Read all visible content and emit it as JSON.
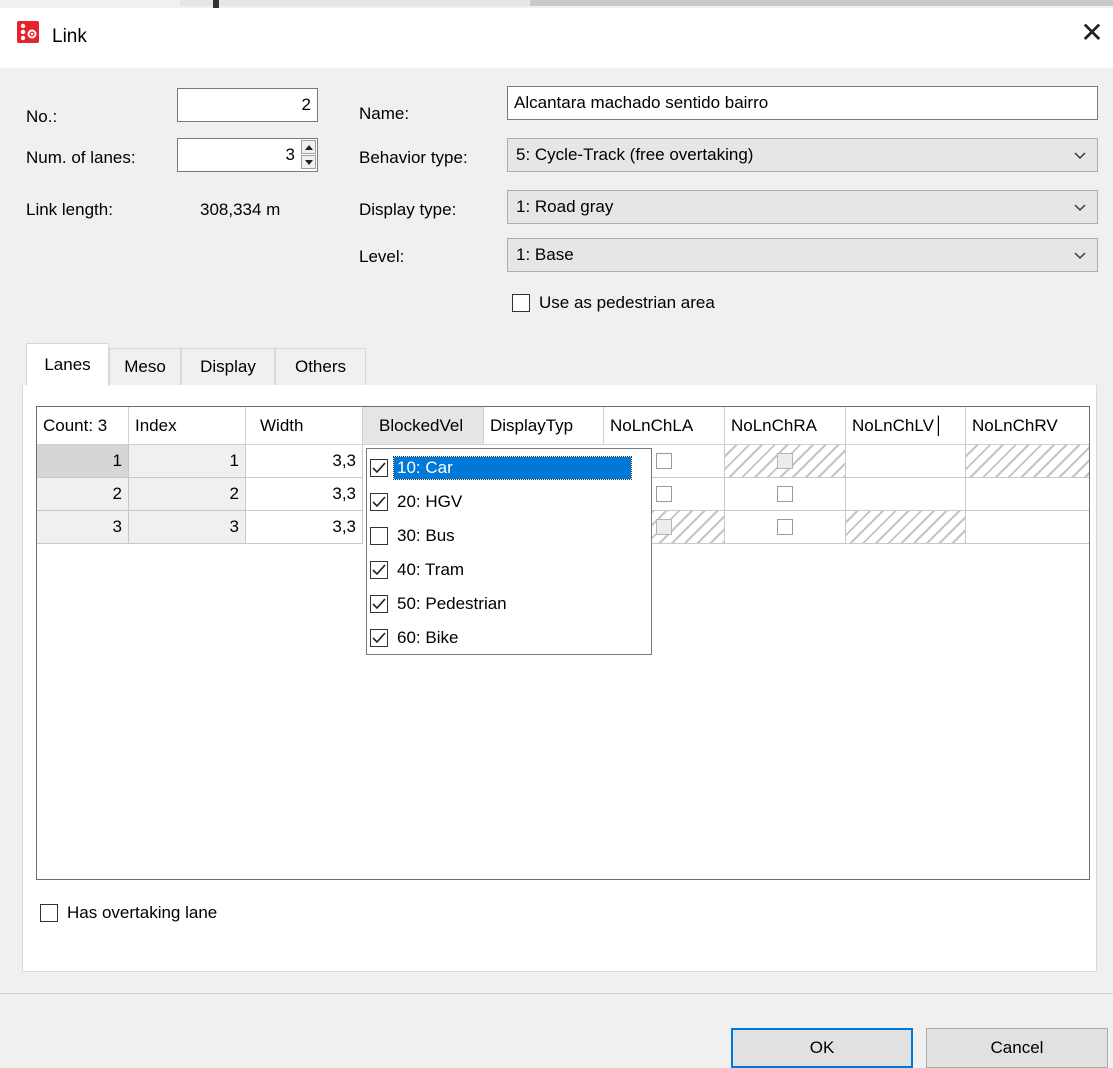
{
  "window": {
    "title": "Link",
    "close_glyph": "✕"
  },
  "form": {
    "no_label": "No.:",
    "no_value": "2",
    "lanes_label": "Num. of lanes:",
    "lanes_value": "3",
    "length_label": "Link length:",
    "length_value": "308,334 m",
    "name_label": "Name:",
    "name_value": "Alcantara machado sentido bairro",
    "behavior_label": "Behavior type:",
    "behavior_value": "5: Cycle-Track (free overtaking)",
    "display_label": "Display type:",
    "display_value": "1: Road gray",
    "level_label": "Level:",
    "level_value": "1: Base",
    "pedestrian_label": "Use as pedestrian area",
    "pedestrian_checked": false
  },
  "tabs": [
    "Lanes",
    "Meso",
    "Display",
    "Others"
  ],
  "active_tab": "Lanes",
  "grid": {
    "headers": [
      "Count: 3",
      "Index",
      "Width",
      "BlockedVel",
      "DisplayTyp",
      "NoLnChLA",
      "NoLnChRA",
      "NoLnChLV│",
      "NoLnChRV"
    ],
    "sorted_column": "BlockedVel",
    "rows": [
      {
        "row": "1",
        "index": "1",
        "width": "3,3"
      },
      {
        "row": "2",
        "index": "2",
        "width": "3,3"
      },
      {
        "row": "3",
        "index": "3",
        "width": "3,3"
      }
    ]
  },
  "dropdown": {
    "items": [
      {
        "label": "10: Car",
        "checked": true,
        "selected": true
      },
      {
        "label": "20: HGV",
        "checked": true,
        "selected": false
      },
      {
        "label": "30: Bus",
        "checked": false,
        "selected": false
      },
      {
        "label": "40: Tram",
        "checked": true,
        "selected": false
      },
      {
        "label": "50: Pedestrian",
        "checked": true,
        "selected": false
      },
      {
        "label": "60: Bike",
        "checked": true,
        "selected": false
      }
    ]
  },
  "overtaking_label": "Has overtaking lane",
  "overtaking_checked": false,
  "buttons": {
    "ok": "OK",
    "cancel": "Cancel"
  },
  "colors": {
    "accent": "#0078d7",
    "app_icon": "#e8212d"
  },
  "icons": {
    "app": "app-logo-icon",
    "close": "close-icon",
    "chevron": "chevron-down-icon",
    "check": "check-icon"
  }
}
